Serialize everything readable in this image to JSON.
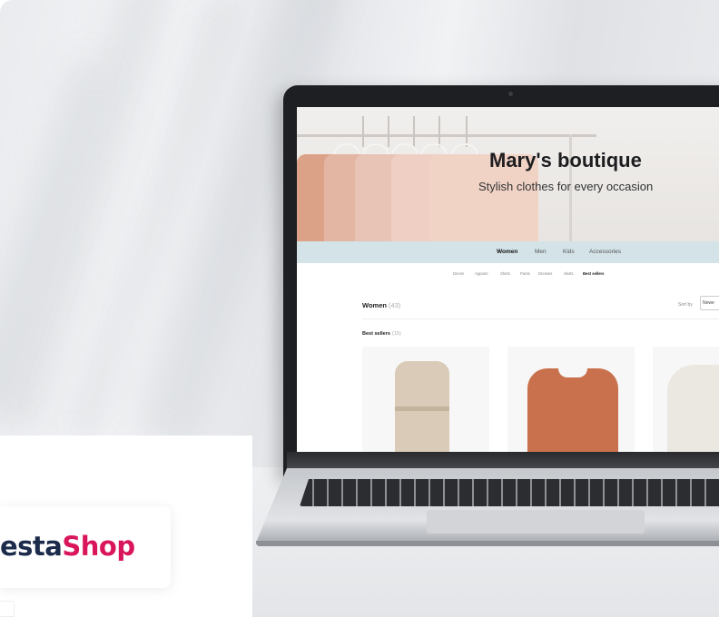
{
  "site": {
    "title": "Mary's boutique",
    "subtitle": "Stylish clothes for every occasion",
    "nav": [
      "Women",
      "Men",
      "Kids",
      "Accessories"
    ],
    "subnav": [
      "Denim",
      "Apparel",
      "Shirts",
      "Pants",
      "Dresses",
      "Skirts",
      "Best sellers"
    ],
    "section_title": "Women",
    "section_count": "(43)",
    "sort_label": "Sort by",
    "sort_value": "Newe",
    "bestsellers_label": "Best sellers",
    "bestsellers_count": "(15)"
  },
  "logo": {
    "part_a": "estaShop",
    "part_b": "Shop",
    "full_visible": "estaShop",
    "brand_color_a": "#1c2b4b",
    "brand_color_b": "#d9155b"
  },
  "colors": {
    "nav_bar": "#d3e3e8",
    "badge": "#d3886a",
    "laptop_bezel": "#1e1f22"
  }
}
